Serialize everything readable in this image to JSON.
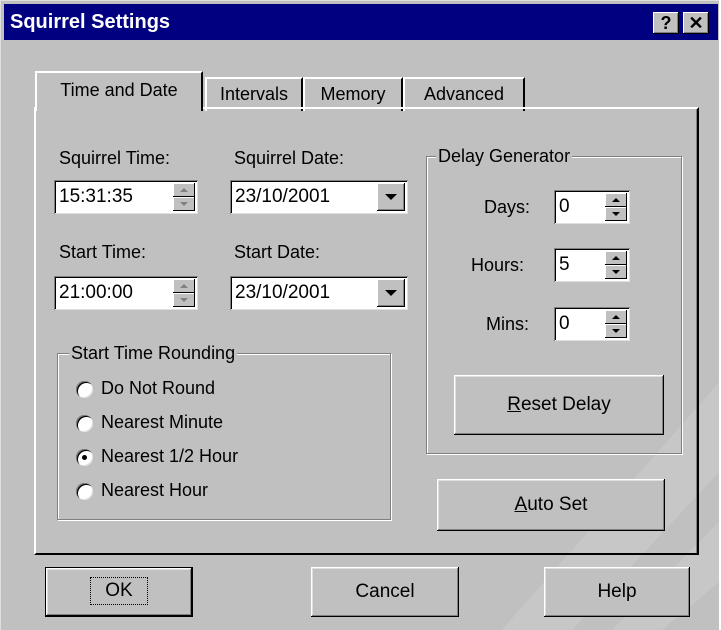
{
  "window": {
    "title": "Squirrel Settings",
    "help_glyph": "?",
    "close_glyph": "✕"
  },
  "tabs": [
    {
      "label": "Time and Date",
      "active": true
    },
    {
      "label": "Intervals"
    },
    {
      "label": "Memory"
    },
    {
      "label": "Advanced"
    }
  ],
  "squirrel_time": {
    "label": "Squirrel Time:",
    "value": "15:31:35"
  },
  "squirrel_date": {
    "label": "Squirrel Date:",
    "value": "23/10/2001"
  },
  "start_time": {
    "label": "Start Time:",
    "value": "21:00:00"
  },
  "start_date": {
    "label": "Start Date:",
    "value": "23/10/2001"
  },
  "rounding": {
    "title": "Start Time Rounding",
    "options": [
      {
        "label": "Do Not Round",
        "checked": false
      },
      {
        "label": "Nearest Minute",
        "checked": false
      },
      {
        "label": "Nearest 1/2 Hour",
        "checked": true
      },
      {
        "label": "Nearest Hour",
        "checked": false
      }
    ]
  },
  "delay": {
    "title": "Delay Generator",
    "days": {
      "label": "Days:",
      "value": "0"
    },
    "hours": {
      "label": "Hours:",
      "value": "5"
    },
    "mins": {
      "label": "Mins:",
      "value": "0"
    },
    "reset_mnemonic": "R",
    "reset_rest": "eset Delay"
  },
  "auto_set": {
    "mnemonic": "A",
    "rest": "uto Set"
  },
  "buttons": {
    "ok": "OK",
    "cancel": "Cancel",
    "help": "Help"
  },
  "colors": {
    "titlebar": "#000080",
    "face": "#c0c0c0",
    "field": "#ffffff"
  }
}
